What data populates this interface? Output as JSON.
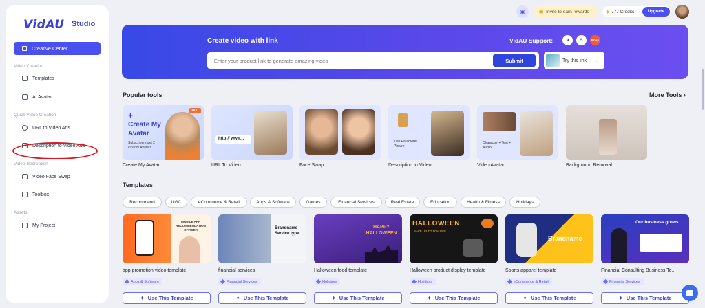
{
  "sidebar": {
    "logo": "VidAU",
    "studio": "Studio",
    "creative_center": "Creative Center",
    "sections": {
      "video_creation": "Video Creation",
      "quick_video_creation": "Quick Video Creation",
      "video_recreation": "Video Recreation",
      "assets": "Assets"
    },
    "items": {
      "templates": "Templates",
      "ai_avatar": "AI Avatar",
      "url_to_video_ads": "URL to Video Ads",
      "description_to_video_ads": "Description to Video Ads",
      "video_face_swap": "Video Face Swap",
      "toolbox": "Toolbox",
      "my_project": "My Project"
    }
  },
  "topbar": {
    "invite": "Invite to earn rewards",
    "credits": "777 Credits",
    "upgrade": "Upgrade"
  },
  "hero": {
    "title": "Create video with link",
    "input_placeholder": "Enter your product link to generate amazing video",
    "submit": "Submit",
    "support": "VidAU Support:",
    "brands": [
      "a",
      "S",
      "Ebay"
    ],
    "try_link": "Try this link"
  },
  "popular_tools": {
    "title": "Popular tools",
    "more": "More Tools",
    "items": [
      {
        "label": "Create My Avatar",
        "thumb_title": "Create My Avatar",
        "thumb_sub": "Subscribers get 2 custom Avatars",
        "badge": "HOT"
      },
      {
        "label": "URL To Video",
        "thumb_text": "http:// www..."
      },
      {
        "label": "Face Swap"
      },
      {
        "label": "Description to Video",
        "thumb_text": "Title Parameter Picture"
      },
      {
        "label": "Video Avatar",
        "thumb_text": "Character + Text + Audio"
      },
      {
        "label": "Background Removal"
      }
    ]
  },
  "templates": {
    "title": "Templates",
    "chips": [
      "Recommend",
      "UGC",
      "eCommerce & Retail",
      "Apps & Software",
      "Games",
      "Financial Services",
      "Real Estate",
      "Education",
      "Health & Fitness",
      "Holidays"
    ],
    "cards": [
      {
        "title": "app promotion video template",
        "tag": "Apps & Software",
        "thumb_text": "MOBILE APP RECOMMENDATION OFFICER"
      },
      {
        "title": "financial services",
        "tag": "Financial Services",
        "thumb_text": "Brandname Service type"
      },
      {
        "title": "Halloween food template",
        "tag": "Holidays",
        "thumb_text": "HAPPY HALLOWEEN"
      },
      {
        "title": "Halloween product display template",
        "tag": "Holidays",
        "thumb_text": "HALLOWEEN",
        "thumb_sub": "SAVE UP TO 50% OFF"
      },
      {
        "title": "Sports apparel template",
        "tag": "eCommerce & Retail",
        "thumb_text": "Brandname"
      },
      {
        "title": "Financial Consulting Business Te...",
        "tag": "Financial Services",
        "thumb_text": "Our business grows"
      }
    ],
    "use_button": "Use This Template"
  }
}
